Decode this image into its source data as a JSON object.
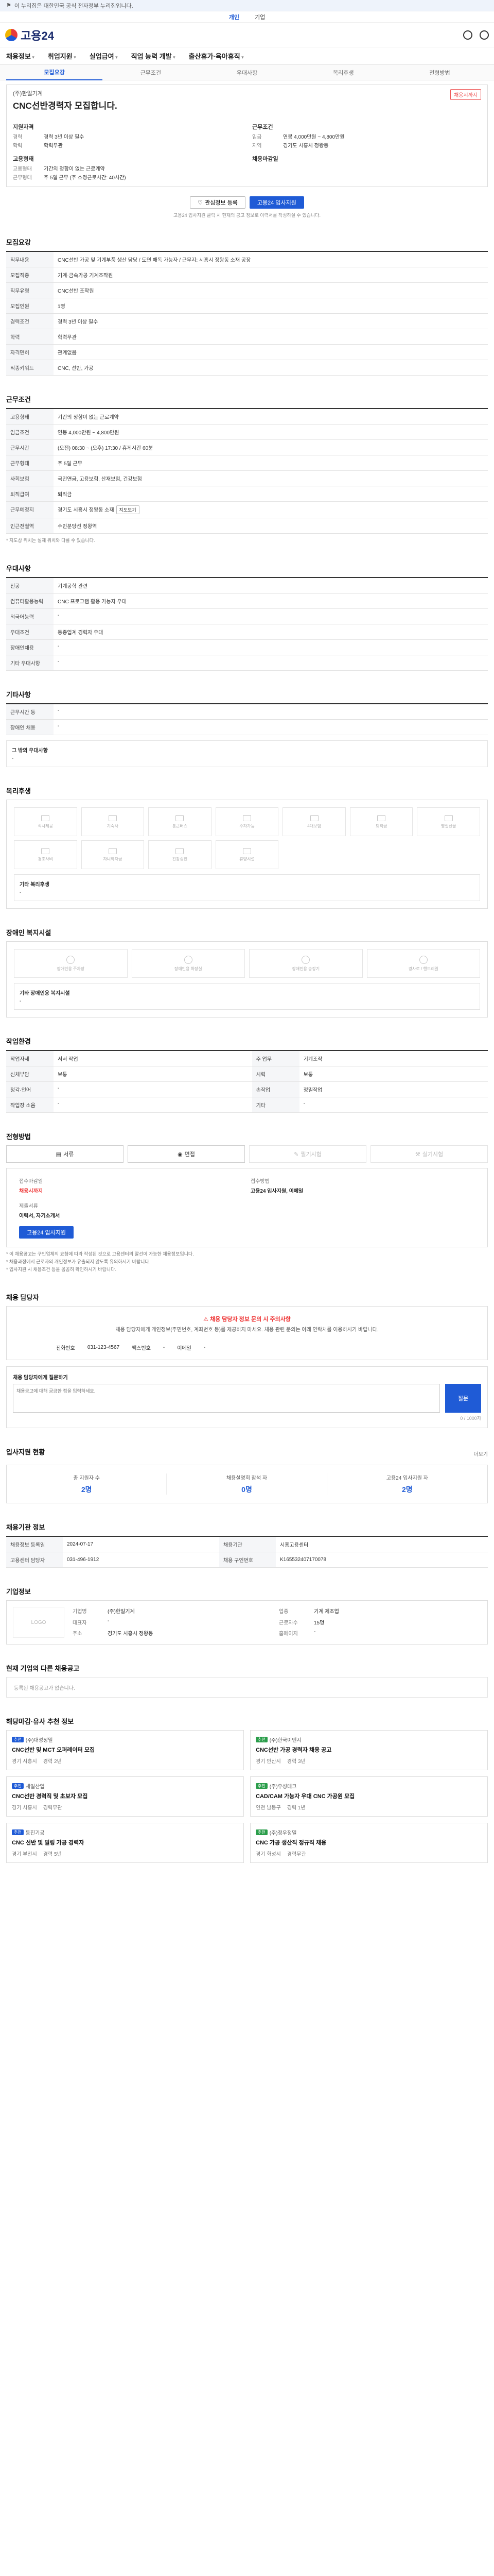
{
  "top_strip": "이 누리집은 대한민국 공식 전자정부 누리집입니다.",
  "sub_strip": {
    "items": [
      "개인",
      "기업"
    ],
    "active": "개인"
  },
  "header": {
    "logo": "고용24"
  },
  "gnb": [
    "채용정보",
    "취업지원",
    "실업급여",
    "직업 능력 개발",
    "출산휴가·육아휴직"
  ],
  "tabs": [
    "모집요강",
    "근무조건",
    "우대사항",
    "복리후생",
    "전형방법"
  ],
  "title_box": {
    "company": "(주)한일기계",
    "title": "CNC선반경력자 모집합니다.",
    "badge": "채용시까지",
    "left_head": "지원자격",
    "left_kv": [
      {
        "k": "경력",
        "v": "경력 3년 이상 필수"
      },
      {
        "k": "학력",
        "v": "학력무관"
      }
    ],
    "right_head": "근무조건",
    "right_kv": [
      {
        "k": "임금",
        "v": "연봉 4,000만원 ~ 4,800만원"
      },
      {
        "k": "지역",
        "v": "경기도 시흥시 정왕동"
      }
    ],
    "left2_head": "고용형태",
    "left2_kv": [
      {
        "k": "고용형태",
        "v": "기간의 정함이 없는 근로계약"
      },
      {
        "k": "근무형태",
        "v": "주 5일 근무 (주 소정근로시간: 40시간)"
      }
    ],
    "right2_head": "채용마감일",
    "buttons": {
      "scrap": "관심정보 등록",
      "apply": "고용24 입사지원"
    },
    "note": "고용24 입사지원 클릭 시 현재의 공고 정보로 이력서를 작성하실 수 있습니다."
  },
  "sections": {
    "recruit": {
      "title": "모집요강",
      "rows": [
        {
          "k": "직무내용",
          "v": "CNC선반 가공 및 기계부품 생산 담당 / 도면 해독 가능자 / 근무지: 시흥시 정왕동 소재 공장"
        },
        {
          "k": "모집직종",
          "v": "기계·금속가공 기계조작원"
        },
        {
          "k": "직무유형",
          "v": "CNC선반 조작원"
        },
        {
          "k": "모집인원",
          "v": "1명"
        },
        {
          "k": "경력조건",
          "v": "경력 3년 이상 필수"
        },
        {
          "k": "학력",
          "v": "학력무관"
        },
        {
          "k": "자격면허",
          "v": "관계없음"
        }
      ],
      "extra_k": "직종키워드",
      "extra_v": "CNC, 선반, 가공"
    },
    "conditions": {
      "title": "근무조건",
      "rows": [
        {
          "k": "고용형태",
          "v": "기간의 정함이 없는 근로계약"
        },
        {
          "k": "임금조건",
          "v": "연봉 4,000만원 ~ 4,800만원"
        },
        {
          "k": "근무시간",
          "v": "(오전) 08:30 ~ (오후) 17:30 / 휴게시간 60분"
        },
        {
          "k": "근무형태",
          "v": "주 5일 근무"
        },
        {
          "k": "사회보험",
          "v": "국민연금, 고용보험, 산재보험, 건강보험"
        },
        {
          "k": "퇴직급여",
          "v": "퇴직금"
        },
        {
          "k": "근무예정지",
          "v": "경기도 시흥시 정왕동 소재"
        },
        {
          "k": "인근전철역",
          "v": "수인분당선 정왕역"
        }
      ],
      "map_btn": "지도보기",
      "note": "* 지도상 위치는 실제 위치와 다를 수 있습니다."
    },
    "preference": {
      "title": "우대사항",
      "rows": [
        {
          "k": "전공",
          "v": "기계공학 관련"
        },
        {
          "k": "컴퓨터활용능력",
          "v": "CNC 프로그램 활용 가능자 우대"
        },
        {
          "k": "외국어능력",
          "v": "-"
        },
        {
          "k": "우대조건",
          "v": "동종업계 경력자 우대"
        },
        {
          "k": "장애인채용",
          "v": "-"
        },
        {
          "k": "기타 우대사항",
          "v": "-"
        }
      ]
    },
    "etc": {
      "title": "기타사항",
      "rows": [
        {
          "k": "근무시간 등",
          "v": "-"
        },
        {
          "k": "장애인 채용",
          "v": "-"
        }
      ],
      "box_label": "그 밖의 우대사항",
      "box_value": "-"
    },
    "welfare": {
      "title": "복리후생",
      "items": [
        "식사제공",
        "기숙사",
        "통근버스",
        "주차가능",
        "4대보험",
        "퇴직금",
        "명절선물",
        "경조사비",
        "자녀학자금",
        "건강검진",
        "휴양시설"
      ],
      "etc_label": "기타 복리후생",
      "etc_value": "-"
    },
    "disabled_welfare": {
      "title": "장애인 복지시설",
      "items": [
        "장애인용 주차장",
        "장애인용 화장실",
        "장애인용 승강기",
        "경사로 / 핸드레일"
      ],
      "etc_label": "기타 장애인용 복지시설",
      "etc_value": "-"
    },
    "env": {
      "title": "작업환경",
      "rows": [
        {
          "k": "작업자세",
          "v": "서서 작업",
          "k2": "주 업무",
          "v2": "기계조작"
        },
        {
          "k": "신체부담",
          "v": "보통",
          "k2": "시력",
          "v2": "보통"
        },
        {
          "k": "청각·언어",
          "v": "-",
          "k2": "손작업",
          "v2": "정밀작업"
        },
        {
          "k": "작업장 소음",
          "v": "-",
          "k2": "기타",
          "v2": "-"
        }
      ]
    },
    "process": {
      "title": "전형방법",
      "steps": [
        {
          "label": "서류",
          "dim": false
        },
        {
          "label": "면접",
          "dim": false
        },
        {
          "label": "필기시험",
          "dim": true
        },
        {
          "label": "실기시험",
          "dim": true
        }
      ],
      "deadline_label": "접수마감일",
      "deadline_value": "채용시까지",
      "method_label": "접수방법",
      "method_value": "고용24 입사지원, 이메일",
      "docs_label": "제출서류",
      "docs_value": "이력서, 자기소개서",
      "apply_btn": "고용24 입사지원",
      "notes": [
        "* 이 채용공고는 구인업체의 요청에 따라 작성된 것으로 고용센터의 알선이 가능한 채용정보입니다.",
        "* 채용과정에서 근로자의 개인정보가 유출되지 않도록 유의하시기 바랍니다.",
        "* 입사지원 시 채용조건 등을 꼼꼼히 확인하시기 바랍니다."
      ]
    },
    "manager": {
      "title": "채용 담당자",
      "warn_title": "채용 담당자 정보 문의 시 주의사항",
      "warn_text": "채용 담당자에게 개인정보(주민번호, 계좌번호 등)를 제공하지 마세요. 채용 관련 문의는 아래 연락처를 이용하시기 바랍니다.",
      "phone_label": "전화번호",
      "phone": "031-123-4567",
      "fax_label": "팩스번호",
      "fax": "-",
      "email_label": "이메일",
      "email": "-",
      "qna_label": "채용 담당자에게 질문하기",
      "qna_placeholder": "채용공고에 대해 궁금한 점을 입력하세요.",
      "qna_send": "질문",
      "qna_count": "0 / 1000자"
    },
    "status": {
      "title": "입사지원 현황",
      "more": "더보기",
      "items": [
        {
          "label": "총 지원자 수",
          "value": "2명"
        },
        {
          "label": "채용설명회 참석 자",
          "value": "0명"
        },
        {
          "label": "고용24 입사지원 자",
          "value": "2명"
        }
      ]
    },
    "org": {
      "title": "채용기관 정보",
      "rows": [
        {
          "k": "채용정보 등록일",
          "v": "2024-07-17",
          "k2": "채용기관",
          "v2": "시흥고용센터"
        },
        {
          "k": "고용센터 담당자",
          "v": "031-496-1912",
          "k2": "채용 구인번호",
          "v2": "K165532407170078"
        }
      ]
    },
    "company_info": {
      "title": "기업정보",
      "logo": "LOGO",
      "rows": [
        {
          "k": "기업명",
          "v": "(주)한일기계",
          "k2": "업종",
          "v2": "기계 제조업"
        },
        {
          "k": "대표자",
          "v": "-",
          "k2": "근로자수",
          "v2": "15명"
        },
        {
          "k": "주소",
          "v": "경기도 시흥시 정왕동",
          "k2": "홈페이지",
          "v2": "-"
        }
      ]
    },
    "other_jobs": {
      "title": "현재 기업의 다른 채용공고",
      "empty": "등록된 채용공고가 없습니다."
    },
    "similar": {
      "title": "해당마감·유사 추천 정보",
      "cards": [
        {
          "tag": "추천",
          "company": "(주)대성정밀",
          "title": "CNC선반 및 MCT 오퍼레이터 모집",
          "meta1": "경기 시흥시",
          "meta2": "경력 2년"
        },
        {
          "tag": "추천",
          "company": "(주)한국이엔지",
          "title": "CNC선반 가공 경력자 채용 공고",
          "meta1": "경기 안산시",
          "meta2": "경력 3년"
        },
        {
          "tag": "추천",
          "company": "세일산업",
          "title": "CNC선반 경력직 및 초보자 모집",
          "meta1": "경기 시흥시",
          "meta2": "경력무관"
        },
        {
          "tag": "추천",
          "company": "(주)우성테크",
          "title": "CAD/CAM 가능자 우대 CNC 가공원 모집",
          "meta1": "인천 남동구",
          "meta2": "경력 1년"
        },
        {
          "tag": "추천",
          "company": "동진기공",
          "title": "CNC 선반 및 밀링 가공 경력자",
          "meta1": "경기 부천시",
          "meta2": "경력 5년"
        },
        {
          "tag": "추천",
          "company": "(주)정우정밀",
          "title": "CNC 가공 생산직 정규직 채용",
          "meta1": "경기 화성시",
          "meta2": "경력무관"
        }
      ]
    }
  }
}
